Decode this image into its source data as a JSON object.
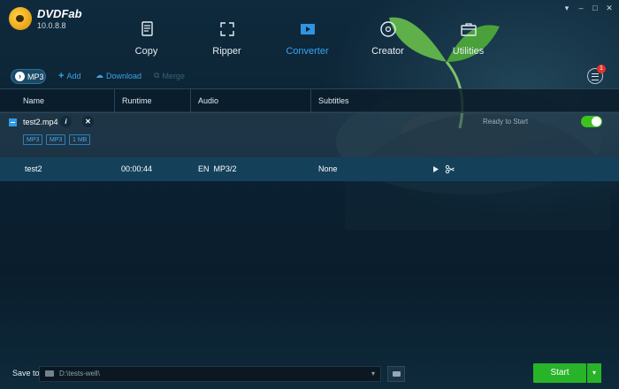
{
  "app": {
    "name": "DVDFab",
    "version": "10.0.8.8"
  },
  "window_controls": [
    "minimize-icon",
    "maximize-icon",
    "close-icon"
  ],
  "nav": [
    {
      "label": "Copy",
      "icon": "copy-icon"
    },
    {
      "label": "Ripper",
      "icon": "ripper-icon"
    },
    {
      "label": "Converter",
      "icon": "converter-icon",
      "active": true
    },
    {
      "label": "Creator",
      "icon": "creator-icon"
    },
    {
      "label": "Utilities",
      "icon": "utilities-icon"
    }
  ],
  "toolbar": {
    "profile_label": "MP3",
    "add_label": "Add",
    "download_label": "Download",
    "merge_label": "Merge",
    "task_badge": "1"
  },
  "columns": [
    "Name",
    "Runtime",
    "Audio",
    "Subtitles"
  ],
  "file": {
    "name": "test2.mp4",
    "chips": [
      "MP3",
      "MP3",
      "1 MB"
    ],
    "status": "Ready to Start",
    "enabled": true
  },
  "title_row": {
    "name": "test2",
    "runtime": "00:00:44",
    "audio": "EN  MP3/2",
    "subtitles": "None"
  },
  "bottom": {
    "save_to_label": "Save to:",
    "path": "D:\\tests-well\\",
    "start_label": "Start"
  },
  "colors": {
    "accent": "#35a7f2",
    "start": "#28b428",
    "toggle": "#3fc21f"
  }
}
